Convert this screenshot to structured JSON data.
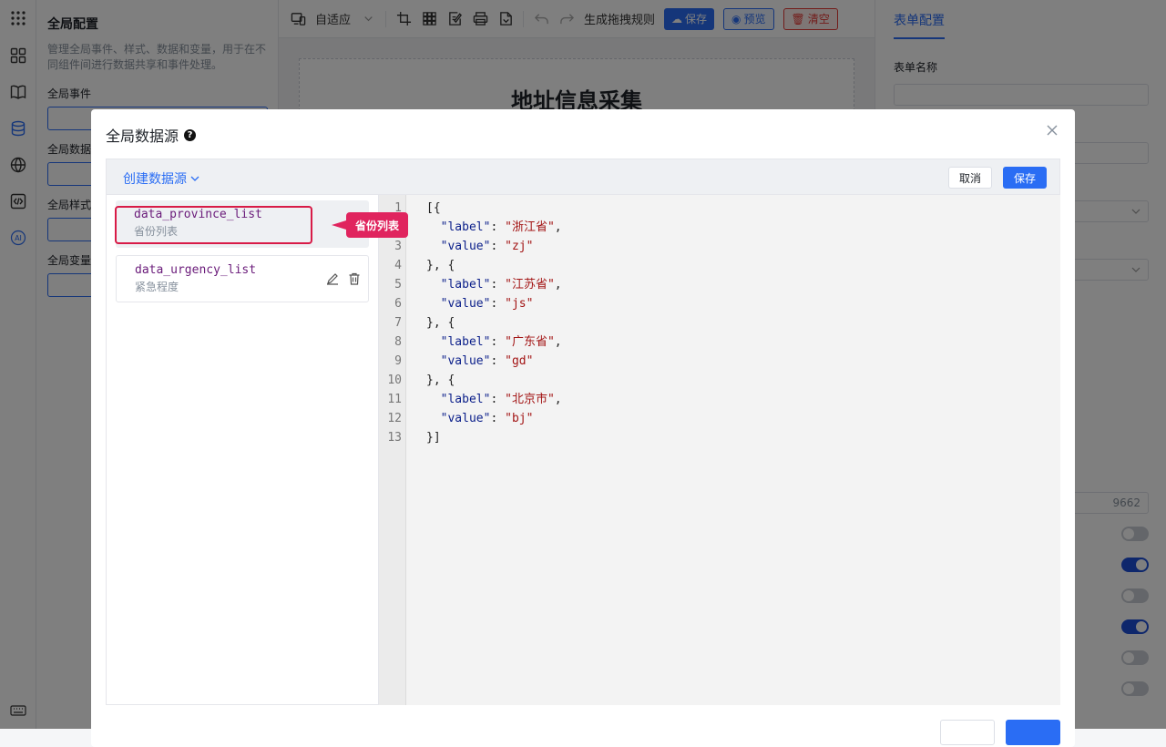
{
  "left_panel": {
    "title": "全局配置",
    "description": "管理全局事件、样式、数据和变量，用于在不同组件间进行数据共享和事件处理。",
    "sections": [
      "全局事件",
      "全局数据",
      "全局样式",
      "全局变量"
    ]
  },
  "toolbar": {
    "device_mode": "自适应",
    "generate_rules": "生成拖拽规则",
    "save": "保存",
    "preview": "预览",
    "clear": "清空"
  },
  "canvas": {
    "form_title": "地址信息采集"
  },
  "right_panel": {
    "tab": "表单配置",
    "form_name_label": "表单名称",
    "partial_value": "9662",
    "toggles": [
      false,
      true,
      false,
      true,
      false,
      false
    ]
  },
  "modal": {
    "title": "全局数据源",
    "help_icon": "question-icon",
    "create_label": "创建数据源",
    "cancel": "取消",
    "save": "保存",
    "datasources": [
      {
        "name": "data_province_list",
        "desc": "省份列表"
      },
      {
        "name": "data_urgency_list",
        "desc": "紧急程度"
      }
    ],
    "tooltip": "省份列表",
    "code": {
      "line_numbers": [
        "1",
        "2",
        "3",
        "4",
        "5",
        "6",
        "7",
        "8",
        "9",
        "10",
        "11",
        "12",
        "13"
      ],
      "items": [
        {
          "label": "浙江省",
          "value": "zj"
        },
        {
          "label": "江苏省",
          "value": "js"
        },
        {
          "label": "广东省",
          "value": "gd"
        },
        {
          "label": "北京市",
          "value": "bj"
        }
      ]
    }
  },
  "colors": {
    "accent": "#2a6df4",
    "highlight": "#e0245e",
    "danger": "#e53935"
  }
}
